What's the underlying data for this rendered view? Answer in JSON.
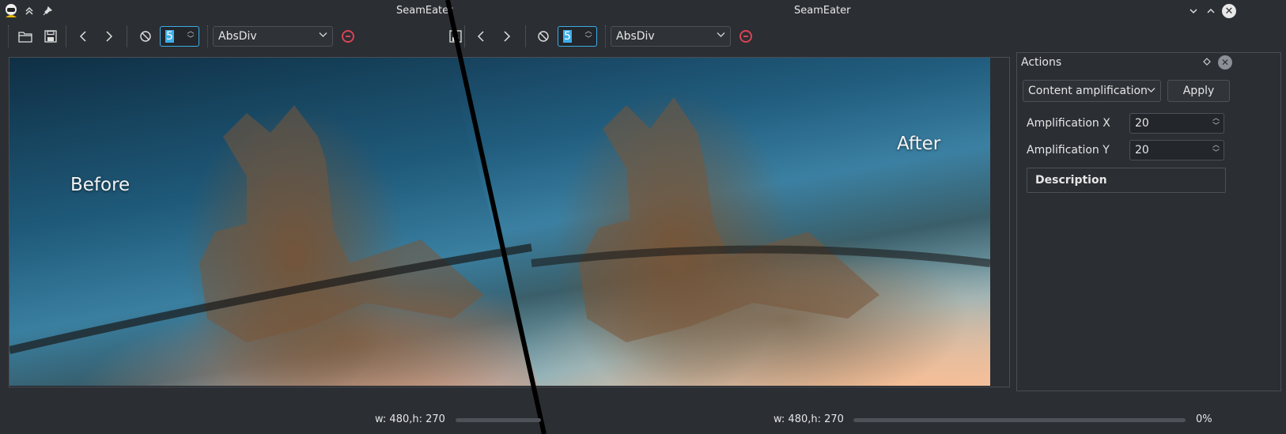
{
  "window": {
    "title_left": "SeamEater",
    "title_right": "SeamEater"
  },
  "toolbar_left": {
    "spin_value": "5",
    "mode": "AbsDiv"
  },
  "toolbar_right": {
    "spin_value": "5",
    "mode": "AbsDiv"
  },
  "image": {
    "label_before": "Before",
    "label_after": "After"
  },
  "status": {
    "left_size": "w: 480,h: 270",
    "right_size": "w: 480,h: 270",
    "progress_text": "0%",
    "progress_value": 0
  },
  "panel": {
    "title": "Actions",
    "action_select": "Content amplification",
    "apply_label": "Apply",
    "amp_x_label": "Amplification X",
    "amp_x_value": "20",
    "amp_y_label": "Amplification Y",
    "amp_y_value": "20",
    "description_label": "Description"
  },
  "colors": {
    "accent": "#3daee9",
    "danger": "#da4453",
    "background": "#2b2e33"
  }
}
